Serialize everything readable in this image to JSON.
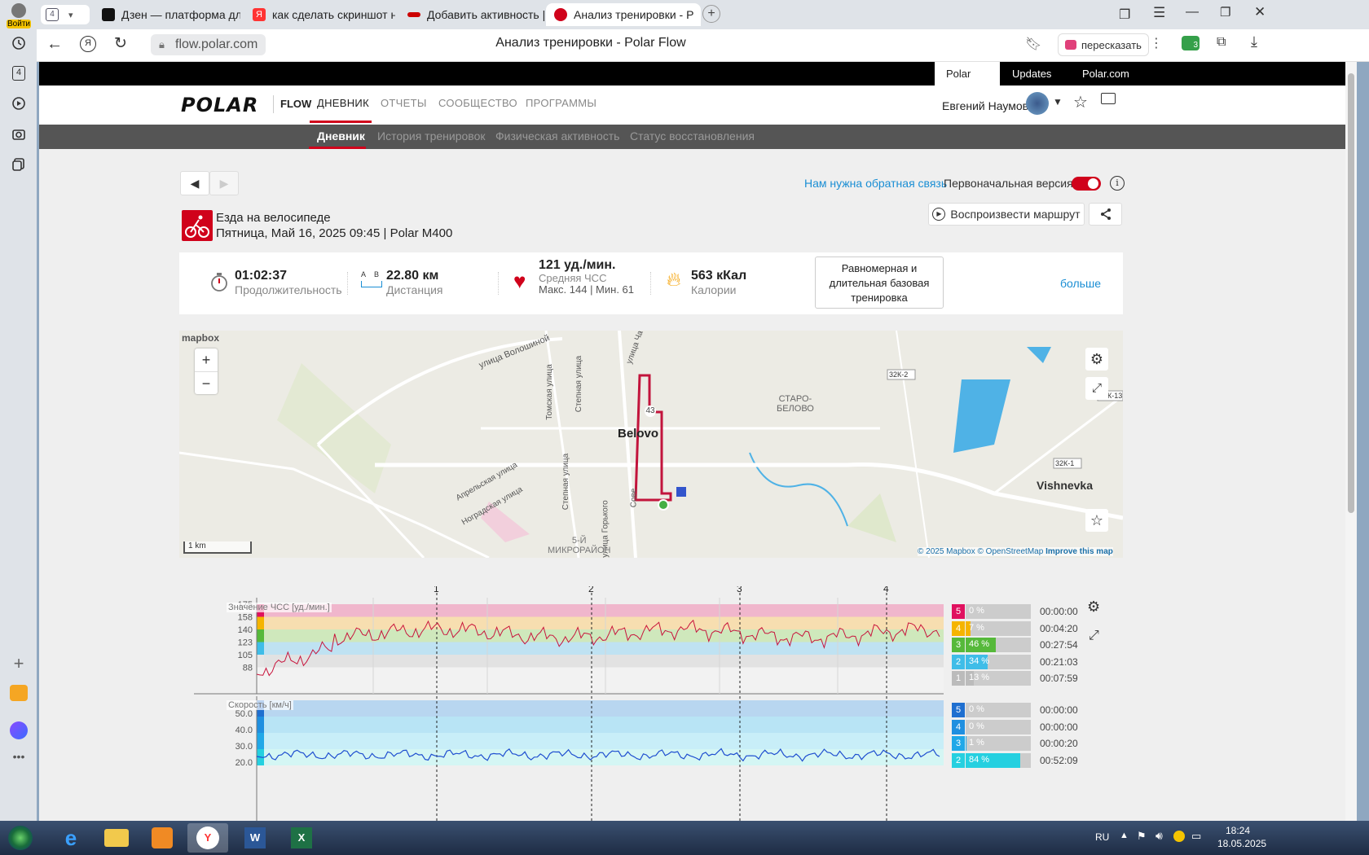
{
  "browser": {
    "login_label": "Войти",
    "tab_count": "4",
    "tabs": [
      {
        "title": "Дзен — платформа для п",
        "color": "#111"
      },
      {
        "title": "как сделать скриншот на",
        "color": "#f33"
      },
      {
        "title": "Добавить активность | W",
        "color": "#c00"
      },
      {
        "title": "Анализ тренировки - P",
        "color": "#d0021b"
      }
    ],
    "url": "flow.polar.com",
    "page_title": "Анализ тренировки - Polar Flow",
    "retell_label": "пересказать",
    "ext_badge": "3"
  },
  "site": {
    "top_links": [
      "Polar Flow",
      "Updates",
      "Polar.com"
    ],
    "logo": "POLAR",
    "flow_label": "FLOW",
    "nav": [
      "ДНЕВНИК",
      "ОТЧЕТЫ",
      "СООБЩЕСТВО",
      "ПРОГРАММЫ"
    ],
    "user_name": "Евгений Наумов",
    "subnav": [
      "Дневник",
      "История тренировок",
      "Физическая активность",
      "Статус восстановления"
    ]
  },
  "workout": {
    "feedback_link": "Нам нужна обратная связь",
    "original_version_label": "Первоначальная версия",
    "sport": "Езда на велосипеде",
    "datetime": "Пятница, Май 16, 2025 09:45 | Polar M400",
    "replay_label": "Воспроизвести маршрут",
    "duration": "01:02:37",
    "duration_label": "Продолжительность",
    "ab_a": "A",
    "ab_b": "B",
    "distance": "22.80 км",
    "distance_label": "Дистанция",
    "hr": "121 уд./мин.",
    "hr_avg_label": "Средняя ЧСС",
    "hr_minmax": "Макс. 144 | Мин. 61",
    "calories": "563 кКал",
    "calories_label": "Калории",
    "benefit": "Равномерная и длительная базовая тренировка",
    "more_label": "больше"
  },
  "map": {
    "brand": "mapbox",
    "zoom_in": "+",
    "zoom_out": "−",
    "scale": "1 km",
    "labels": {
      "l1": "улица Волошиной",
      "l2": "Томская улица",
      "l3": "Степная улица",
      "l4": "улица Ча",
      "city": "Belovo",
      "city_suffix": "",
      "starobelovo": "СТАРО-\nБЕЛОВО",
      "vishnevka": "Vishnevka",
      "r1": "32К-2",
      "r2": "32К-1",
      "r3": "32К-13",
      "aprel": "Апрельская улица",
      "nograd": "Ноградская улица",
      "stepnaya2": "Степная улица",
      "gorky": "улица Горького",
      "micro": "5-Й\nМИКРОРАЙОН",
      "sovet": "Сове"
    },
    "route_marker": "43",
    "attribution": "© 2025 Mapbox © OpenStreetMap",
    "improve": "Improve this map"
  },
  "hr_chart": {
    "label": "Значение ЧСС [уд./мин.]",
    "yticks": [
      "175",
      "158",
      "140",
      "123",
      "105",
      "88"
    ],
    "laps": [
      "1",
      "2",
      "3",
      "4"
    ],
    "zones": [
      {
        "n": "5",
        "pct": "0 %",
        "time": "00:00:00",
        "frac": 0,
        "color": "#e0115f"
      },
      {
        "n": "4",
        "pct": "7 %",
        "time": "00:04:20",
        "frac": 0.07,
        "color": "#f5b400"
      },
      {
        "n": "3",
        "pct": "46 %",
        "time": "00:27:54",
        "frac": 0.46,
        "color": "#56b93a"
      },
      {
        "n": "2",
        "pct": "34 %",
        "time": "00:21:03",
        "frac": 0.34,
        "color": "#3fbde8"
      },
      {
        "n": "1",
        "pct": "13 %",
        "time": "00:07:59",
        "frac": 0.13,
        "color": "#bbbbbb"
      }
    ]
  },
  "speed_chart": {
    "label": "Скорость [км/ч]",
    "yticks": [
      "50.0",
      "40.0",
      "30.0",
      "20.0"
    ],
    "zones": [
      {
        "n": "5",
        "pct": "0 %",
        "time": "00:00:00",
        "frac": 0,
        "color": "#1f6fd0"
      },
      {
        "n": "4",
        "pct": "0 %",
        "time": "00:00:00",
        "frac": 0,
        "color": "#1f8fe0"
      },
      {
        "n": "3",
        "pct": "1 %",
        "time": "00:00:20",
        "frac": 0.01,
        "color": "#20a8e8"
      },
      {
        "n": "2",
        "pct": "84 %",
        "time": "00:52:09",
        "frac": 0.84,
        "color": "#25d0e0"
      }
    ]
  },
  "taskbar": {
    "lang": "RU",
    "time": "18:24",
    "date": "18.05.2025"
  },
  "colors": {
    "polar_red": "#d0021b",
    "accent_blue": "#1a8ed4"
  }
}
